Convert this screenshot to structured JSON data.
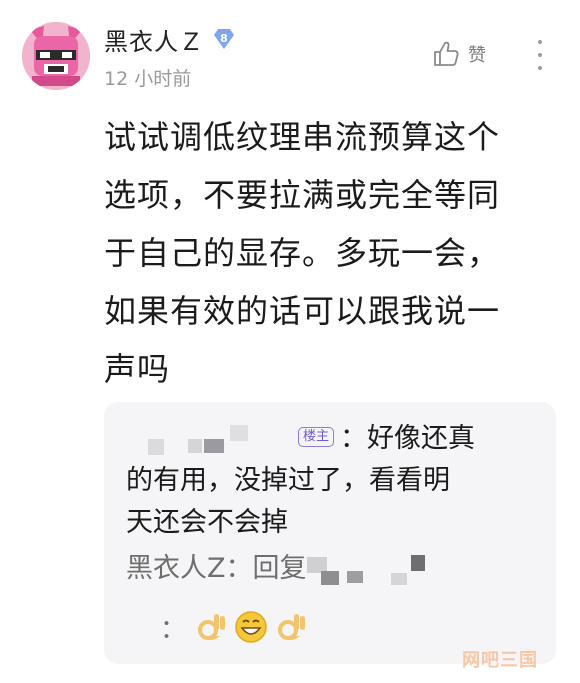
{
  "comment": {
    "author": "黑衣人Ｚ",
    "level": "8",
    "time": "12 小时前",
    "like_label": "赞",
    "lines": [
      "试试调低纹理串流预算这个",
      "选项，不要拉满或完全等同",
      "于自己的显存。多玩一会，",
      "如果有效的话可以跟我说一",
      "声吗"
    ]
  },
  "reply": {
    "host_tag": "楼主",
    "text_first": "：好像还真",
    "text_rest_1": "的有用，没掉过了，看看明",
    "text_rest_2": "天还会不会掉",
    "sub_author": "黑衣人Z",
    "sub_prefix": "：回复",
    "emoji_colon": "："
  },
  "watermark": "网吧三国",
  "colors": {
    "badge": "#7ea7f0",
    "host_tag": "#8f7bdc",
    "reply_bg": "#f5f5f7",
    "watermark": "#f6c8a5"
  },
  "icons": {
    "like": "thumbs-up-icon",
    "more": "more-vertical-icon",
    "level": "diamond-level-badge"
  }
}
